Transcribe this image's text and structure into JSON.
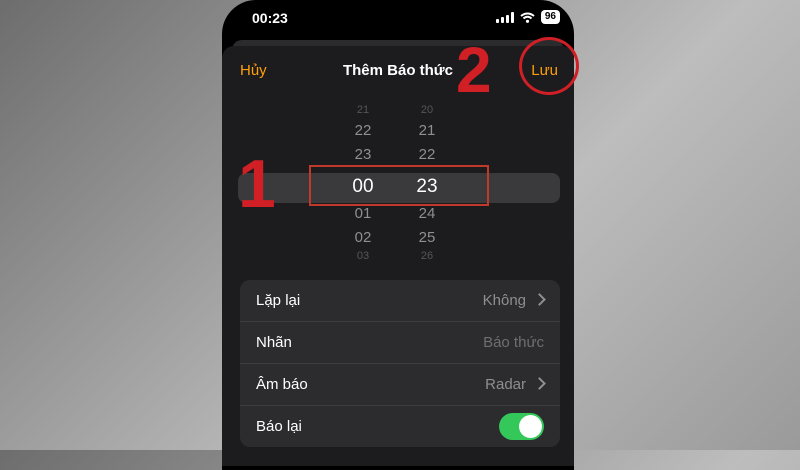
{
  "status_bar": {
    "time": "00:23",
    "battery": "96"
  },
  "nav": {
    "cancel_label": "Hủy",
    "title": "Thêm Báo thức",
    "save_label": "Lưu"
  },
  "picker": {
    "hours": [
      "21",
      "22",
      "23",
      "00",
      "01",
      "02",
      "03"
    ],
    "minutes": [
      "20",
      "21",
      "22",
      "23",
      "24",
      "25",
      "26"
    ],
    "selected_hour": "00",
    "selected_minute": "23"
  },
  "annotations": {
    "step1": "1",
    "step2": "2"
  },
  "settings": {
    "repeat": {
      "label": "Lặp lại",
      "value": "Không"
    },
    "name": {
      "label": "Nhãn",
      "placeholder": "Báo thức"
    },
    "sound": {
      "label": "Âm báo",
      "value": "Radar"
    },
    "snooze": {
      "label": "Báo lại",
      "enabled": true
    }
  },
  "colors": {
    "accent": "#ff9f0a",
    "toggle_on": "#34c759",
    "annotation": "#d11f26"
  }
}
